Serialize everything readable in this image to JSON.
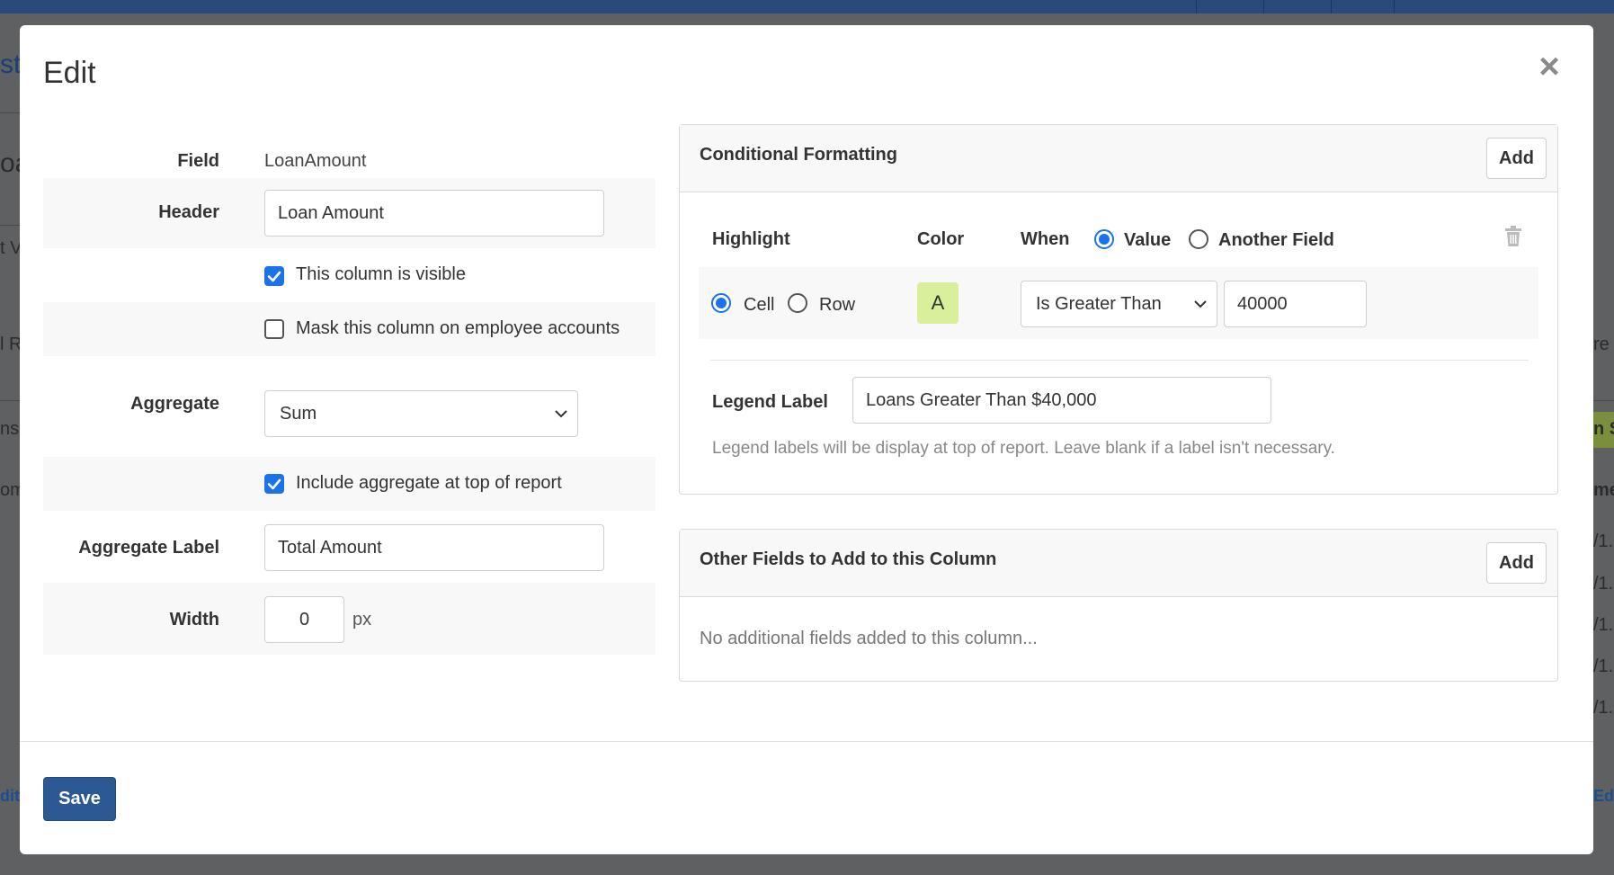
{
  "background": {
    "fragments": [
      "str",
      "oa",
      "t V",
      "l R",
      "ns",
      "om",
      "dit",
      "re",
      "n S",
      "me",
      "/1.",
      "/1.",
      "/1.",
      "/1.",
      "/1.",
      "Ed"
    ]
  },
  "modal": {
    "title": "Edit",
    "close_glyph": "×"
  },
  "form": {
    "field": {
      "label": "Field",
      "value": "LoanAmount"
    },
    "header": {
      "label": "Header",
      "value": "Loan Amount"
    },
    "visible": {
      "label": "This column is visible",
      "checked": true
    },
    "mask": {
      "label": "Mask this column on employee accounts",
      "checked": false
    },
    "aggregate": {
      "label": "Aggregate",
      "selected": "Sum"
    },
    "include_aggregate": {
      "label": "Include aggregate at top of report",
      "checked": true
    },
    "aggregate_label": {
      "label": "Aggregate Label",
      "value": "Total Amount"
    },
    "width": {
      "label": "Width",
      "value": "0",
      "unit": "px"
    }
  },
  "conditional_formatting": {
    "title": "Conditional Formatting",
    "add_label": "Add",
    "columns": {
      "highlight": "Highlight",
      "color": "Color",
      "when": "When"
    },
    "when_options": [
      {
        "label": "Value",
        "selected": true
      },
      {
        "label": "Another Field",
        "selected": false
      }
    ],
    "highlight_options": [
      {
        "label": "Cell",
        "selected": true
      },
      {
        "label": "Row",
        "selected": false
      }
    ],
    "color_swatch": {
      "text": "A",
      "color": "#d9ef9c"
    },
    "condition": {
      "selected": "Is Greater Than"
    },
    "condition_value": "40000",
    "legend": {
      "label": "Legend Label",
      "value": "Loans Greater Than $40,000",
      "help": "Legend labels will be display at top of report. Leave blank if a label isn't necessary."
    }
  },
  "other_fields": {
    "title": "Other Fields to Add to this Column",
    "add_label": "Add",
    "empty_text": "No additional fields added to this column..."
  },
  "footer": {
    "save_label": "Save"
  },
  "colors": {
    "primary": "#2c5893",
    "accent": "#1a73e8",
    "topbar": "#2a4a7c"
  }
}
